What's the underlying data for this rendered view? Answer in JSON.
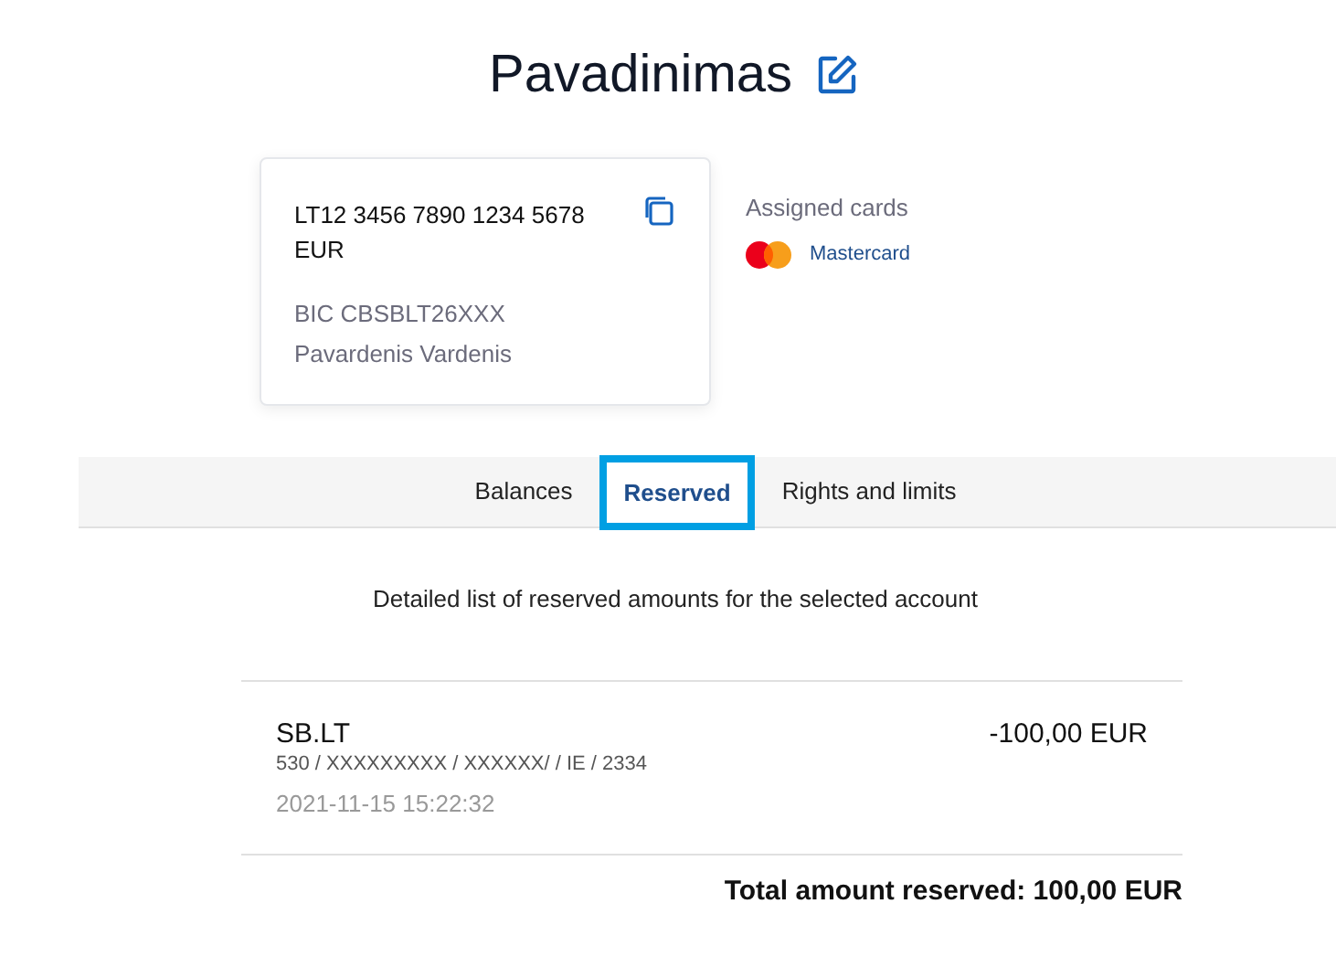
{
  "title": "Pavadinimas",
  "account": {
    "iban": "LT12 3456 7890 1234 5678",
    "currency": "EUR",
    "bic": "BIC CBSBLT26XXX",
    "holder": "Pavardenis Vardenis"
  },
  "assigned_cards": {
    "heading": "Assigned cards",
    "cards": [
      {
        "name": "Mastercard"
      }
    ]
  },
  "tabs": [
    {
      "label": "Balances",
      "selected": false
    },
    {
      "label": "Reserved",
      "selected": true
    },
    {
      "label": "Rights and limits",
      "selected": false
    }
  ],
  "description": "Detailed list of reserved amounts for the selected account",
  "reservations": [
    {
      "merchant": "SB.LT",
      "details": "530 / XXXXXXXXX / XXXXXX/ / IE / 2334",
      "datetime": "2021-11-15 15:22:32",
      "amount": "-100,00 EUR"
    }
  ],
  "total": "Total amount reserved: 100,00 EUR"
}
